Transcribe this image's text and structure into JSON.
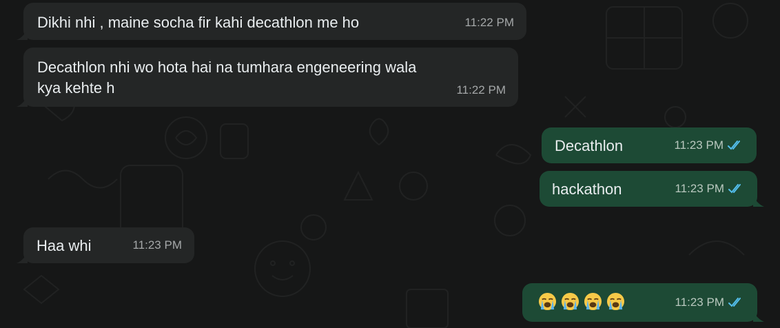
{
  "conversation": {
    "messages": [
      {
        "direction": "in",
        "text": "Dikhi nhi , maine socha fir kahi decathlon me ho",
        "time": "11:22 PM"
      },
      {
        "direction": "in",
        "text_line1": "Decathlon nhi wo hota hai na tumhara engeneering wala",
        "text_line2": "kya kehte h",
        "time": "11:22 PM"
      },
      {
        "direction": "out",
        "text": "Decathlon",
        "time": "11:23 PM",
        "status": "read"
      },
      {
        "direction": "out",
        "text": "hackathon",
        "time": "11:23 PM",
        "status": "read"
      },
      {
        "direction": "in",
        "text": "Haa whi",
        "time": "11:23 PM"
      },
      {
        "direction": "out",
        "emoji": [
          "loudly-crying-face",
          "loudly-crying-face",
          "loudly-crying-face",
          "loudly-crying-face"
        ],
        "time": "11:23 PM",
        "status": "read"
      }
    ]
  },
  "colors": {
    "background": "#161717",
    "incoming_bubble": "#242626",
    "outgoing_bubble": "#1d4a35",
    "read_ticks": "#53bdeb"
  }
}
